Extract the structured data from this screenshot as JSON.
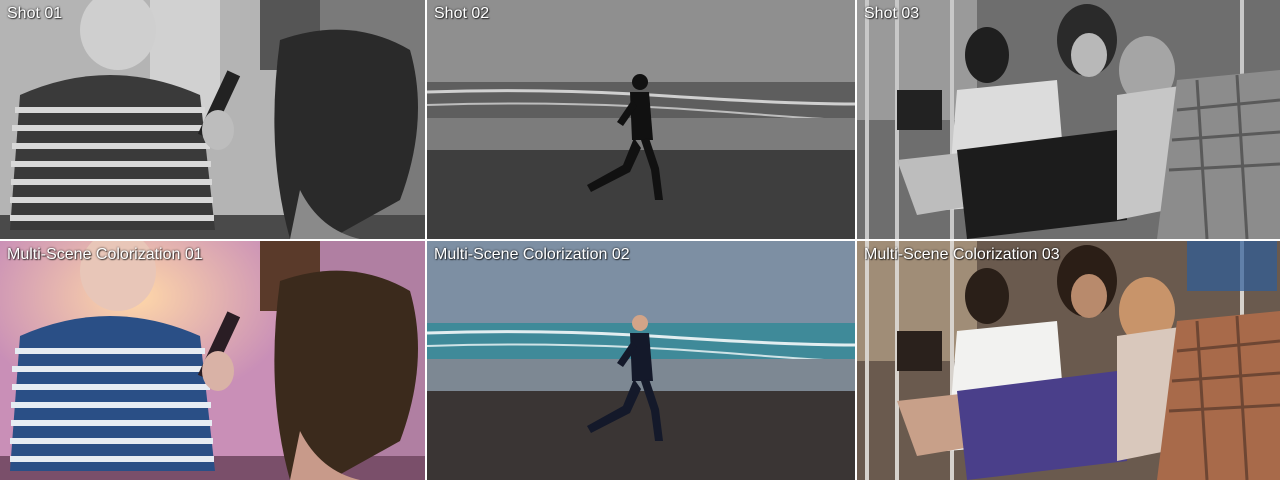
{
  "panels": {
    "top": [
      "Shot 01",
      "Shot 02",
      "Shot 03"
    ],
    "bottom": [
      "Multi-Scene Colorization 01",
      "Multi-Scene Colorization 02",
      "Multi-Scene Colorization 03"
    ]
  },
  "palette": {
    "mirror_pink": "#c98fb7",
    "sea_teal": "#4b8f9a",
    "backpack_purple": "#4a3f8a",
    "hair_brown": "#3b2a1c"
  }
}
